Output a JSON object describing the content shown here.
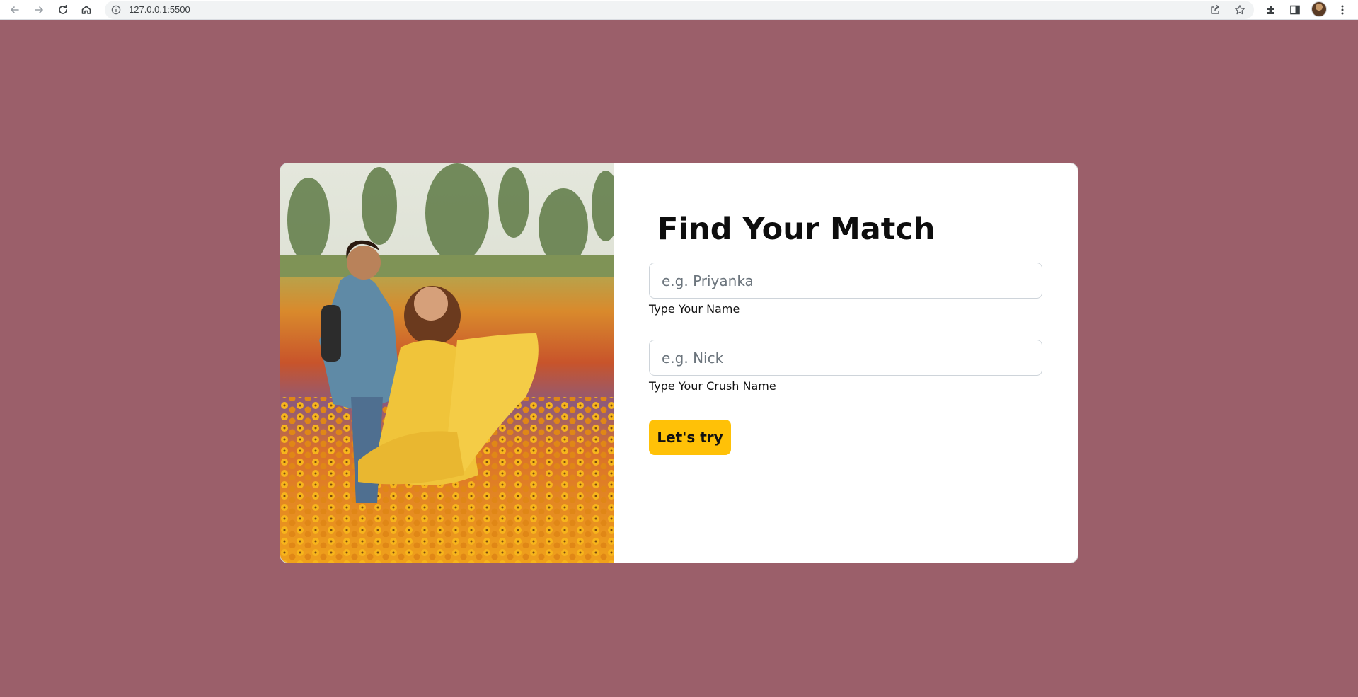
{
  "browser": {
    "url": "127.0.0.1:5500",
    "icons": [
      "back-icon",
      "forward-icon",
      "reload-icon",
      "home-icon",
      "site-info-icon",
      "share-icon",
      "bookmark-star-icon",
      "extensions-icon",
      "side-panel-icon",
      "profile-avatar",
      "menu-icon"
    ]
  },
  "page": {
    "background_color": "#9b5f6a",
    "card": {
      "image_alt": "couple in a field of yellow and orange flowers",
      "form": {
        "title": "Find Your Match",
        "name_field": {
          "placeholder": "e.g. Priyanka",
          "value": "",
          "hint": "Type Your Name"
        },
        "crush_field": {
          "placeholder": "e.g. Nick",
          "value": "",
          "hint": "Type Your Crush Name"
        },
        "submit_label": "Let's try",
        "accent_color": "#ffc107"
      }
    }
  }
}
